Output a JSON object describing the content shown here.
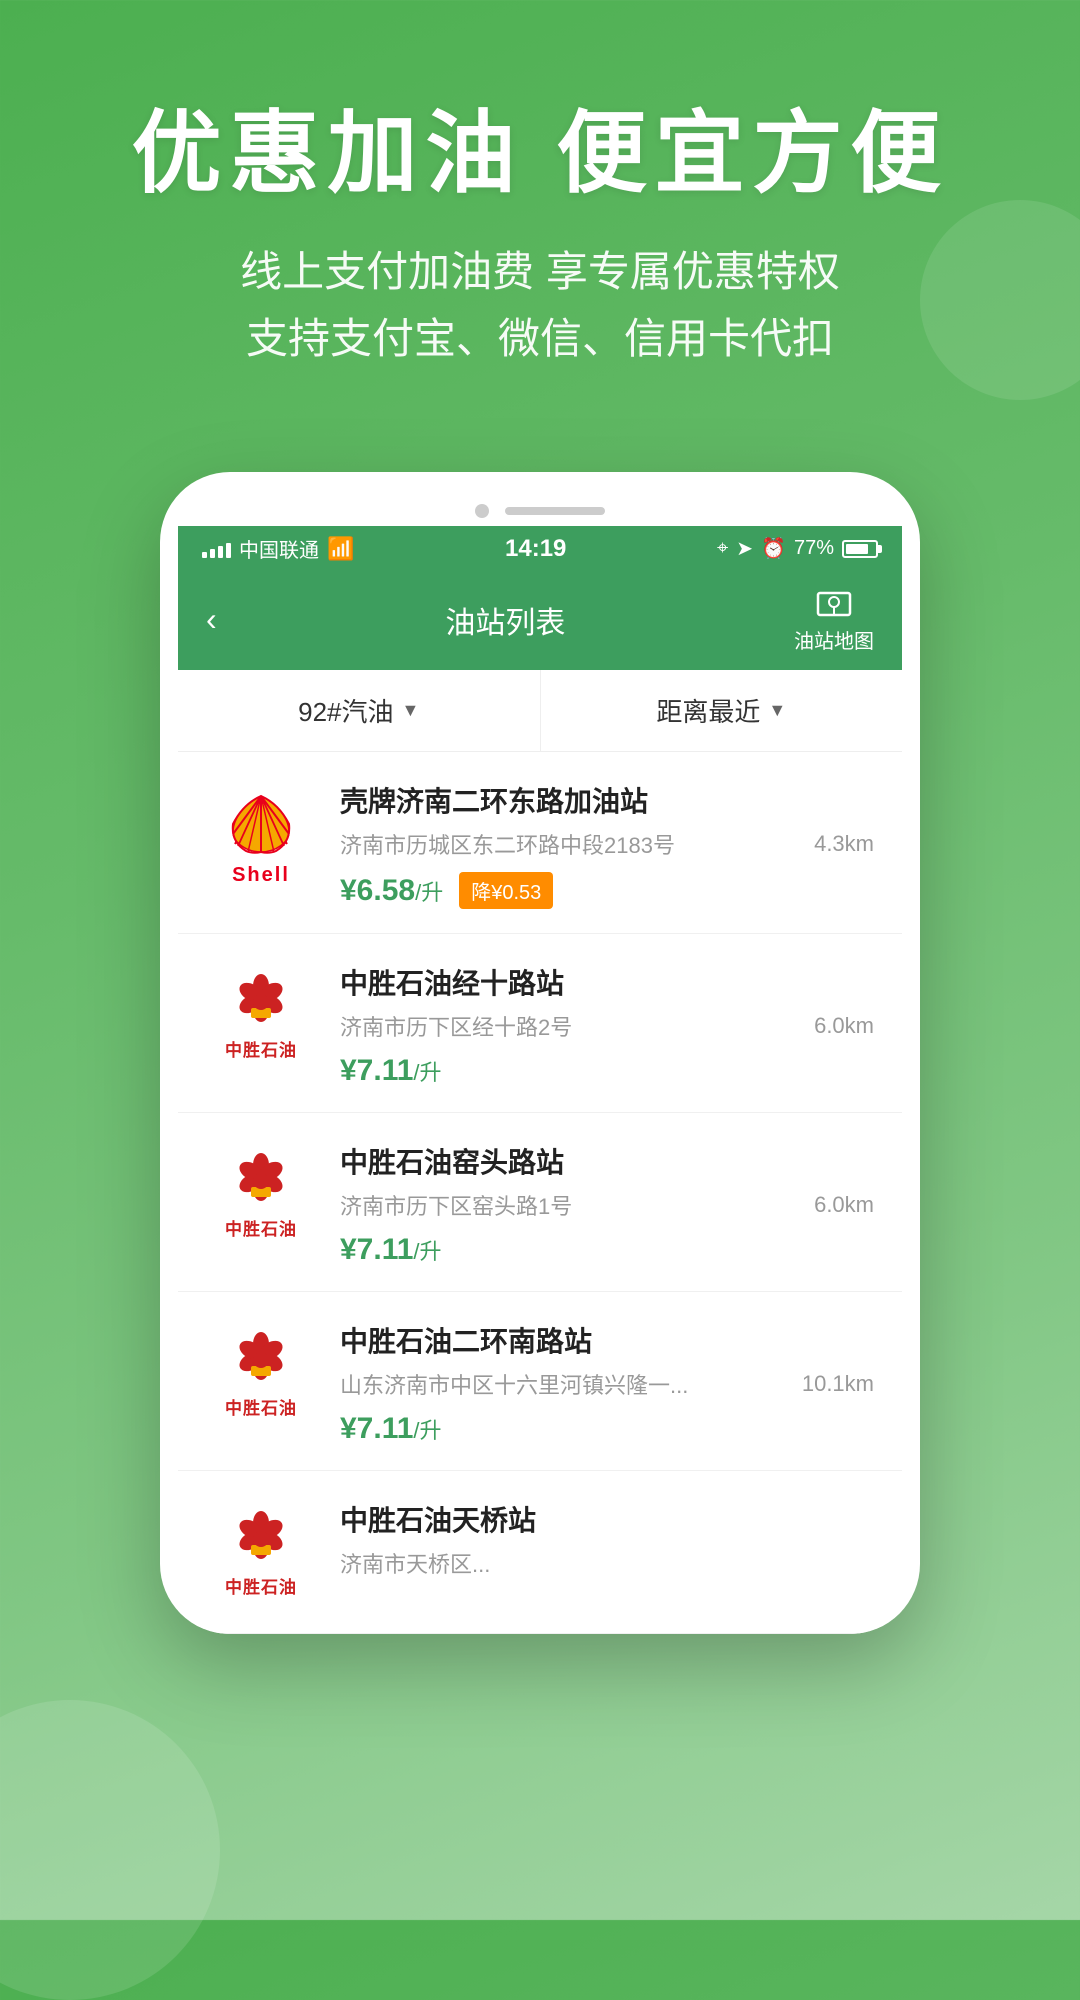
{
  "hero": {
    "title": "优惠加油 便宜方便",
    "subtitle_line1": "线上支付加油费 享专属优惠特权",
    "subtitle_line2": "支持支付宝、微信、信用卡代扣"
  },
  "status_bar": {
    "carrier": "中国联通",
    "wifi": "wifi",
    "time": "14:19",
    "battery_percent": "77%"
  },
  "nav_bar": {
    "back_icon": "‹",
    "title": "油站列表",
    "map_button_label": "油站地图"
  },
  "filters": {
    "fuel_type": "92#汽油",
    "sort_by": "距离最近"
  },
  "stations": [
    {
      "name": "壳牌济南二环东路加油站",
      "address": "济南市历城区东二环路中段2183号",
      "distance": "4.3km",
      "price": "¥6.58",
      "price_unit": "/升",
      "discount": "降¥0.53",
      "brand": "shell"
    },
    {
      "name": "中胜石油经十路站",
      "address": "济南市历下区经十路2号",
      "distance": "6.0km",
      "price": "¥7.11",
      "price_unit": "/升",
      "discount": "",
      "brand": "zhongsheng"
    },
    {
      "name": "中胜石油窑头路站",
      "address": "济南市历下区窑头路1号",
      "distance": "6.0km",
      "price": "¥7.11",
      "price_unit": "/升",
      "discount": "",
      "brand": "zhongsheng"
    },
    {
      "name": "中胜石油二环南路站",
      "address": "山东济南市中区十六里河镇兴隆一...",
      "distance": "10.1km",
      "price": "¥7.11",
      "price_unit": "/升",
      "discount": "",
      "brand": "zhongsheng"
    },
    {
      "name": "中胜石油天桥站",
      "address": "济南市天桥区...",
      "distance": "",
      "price": "",
      "price_unit": "",
      "discount": "",
      "brand": "zhongsheng"
    }
  ]
}
